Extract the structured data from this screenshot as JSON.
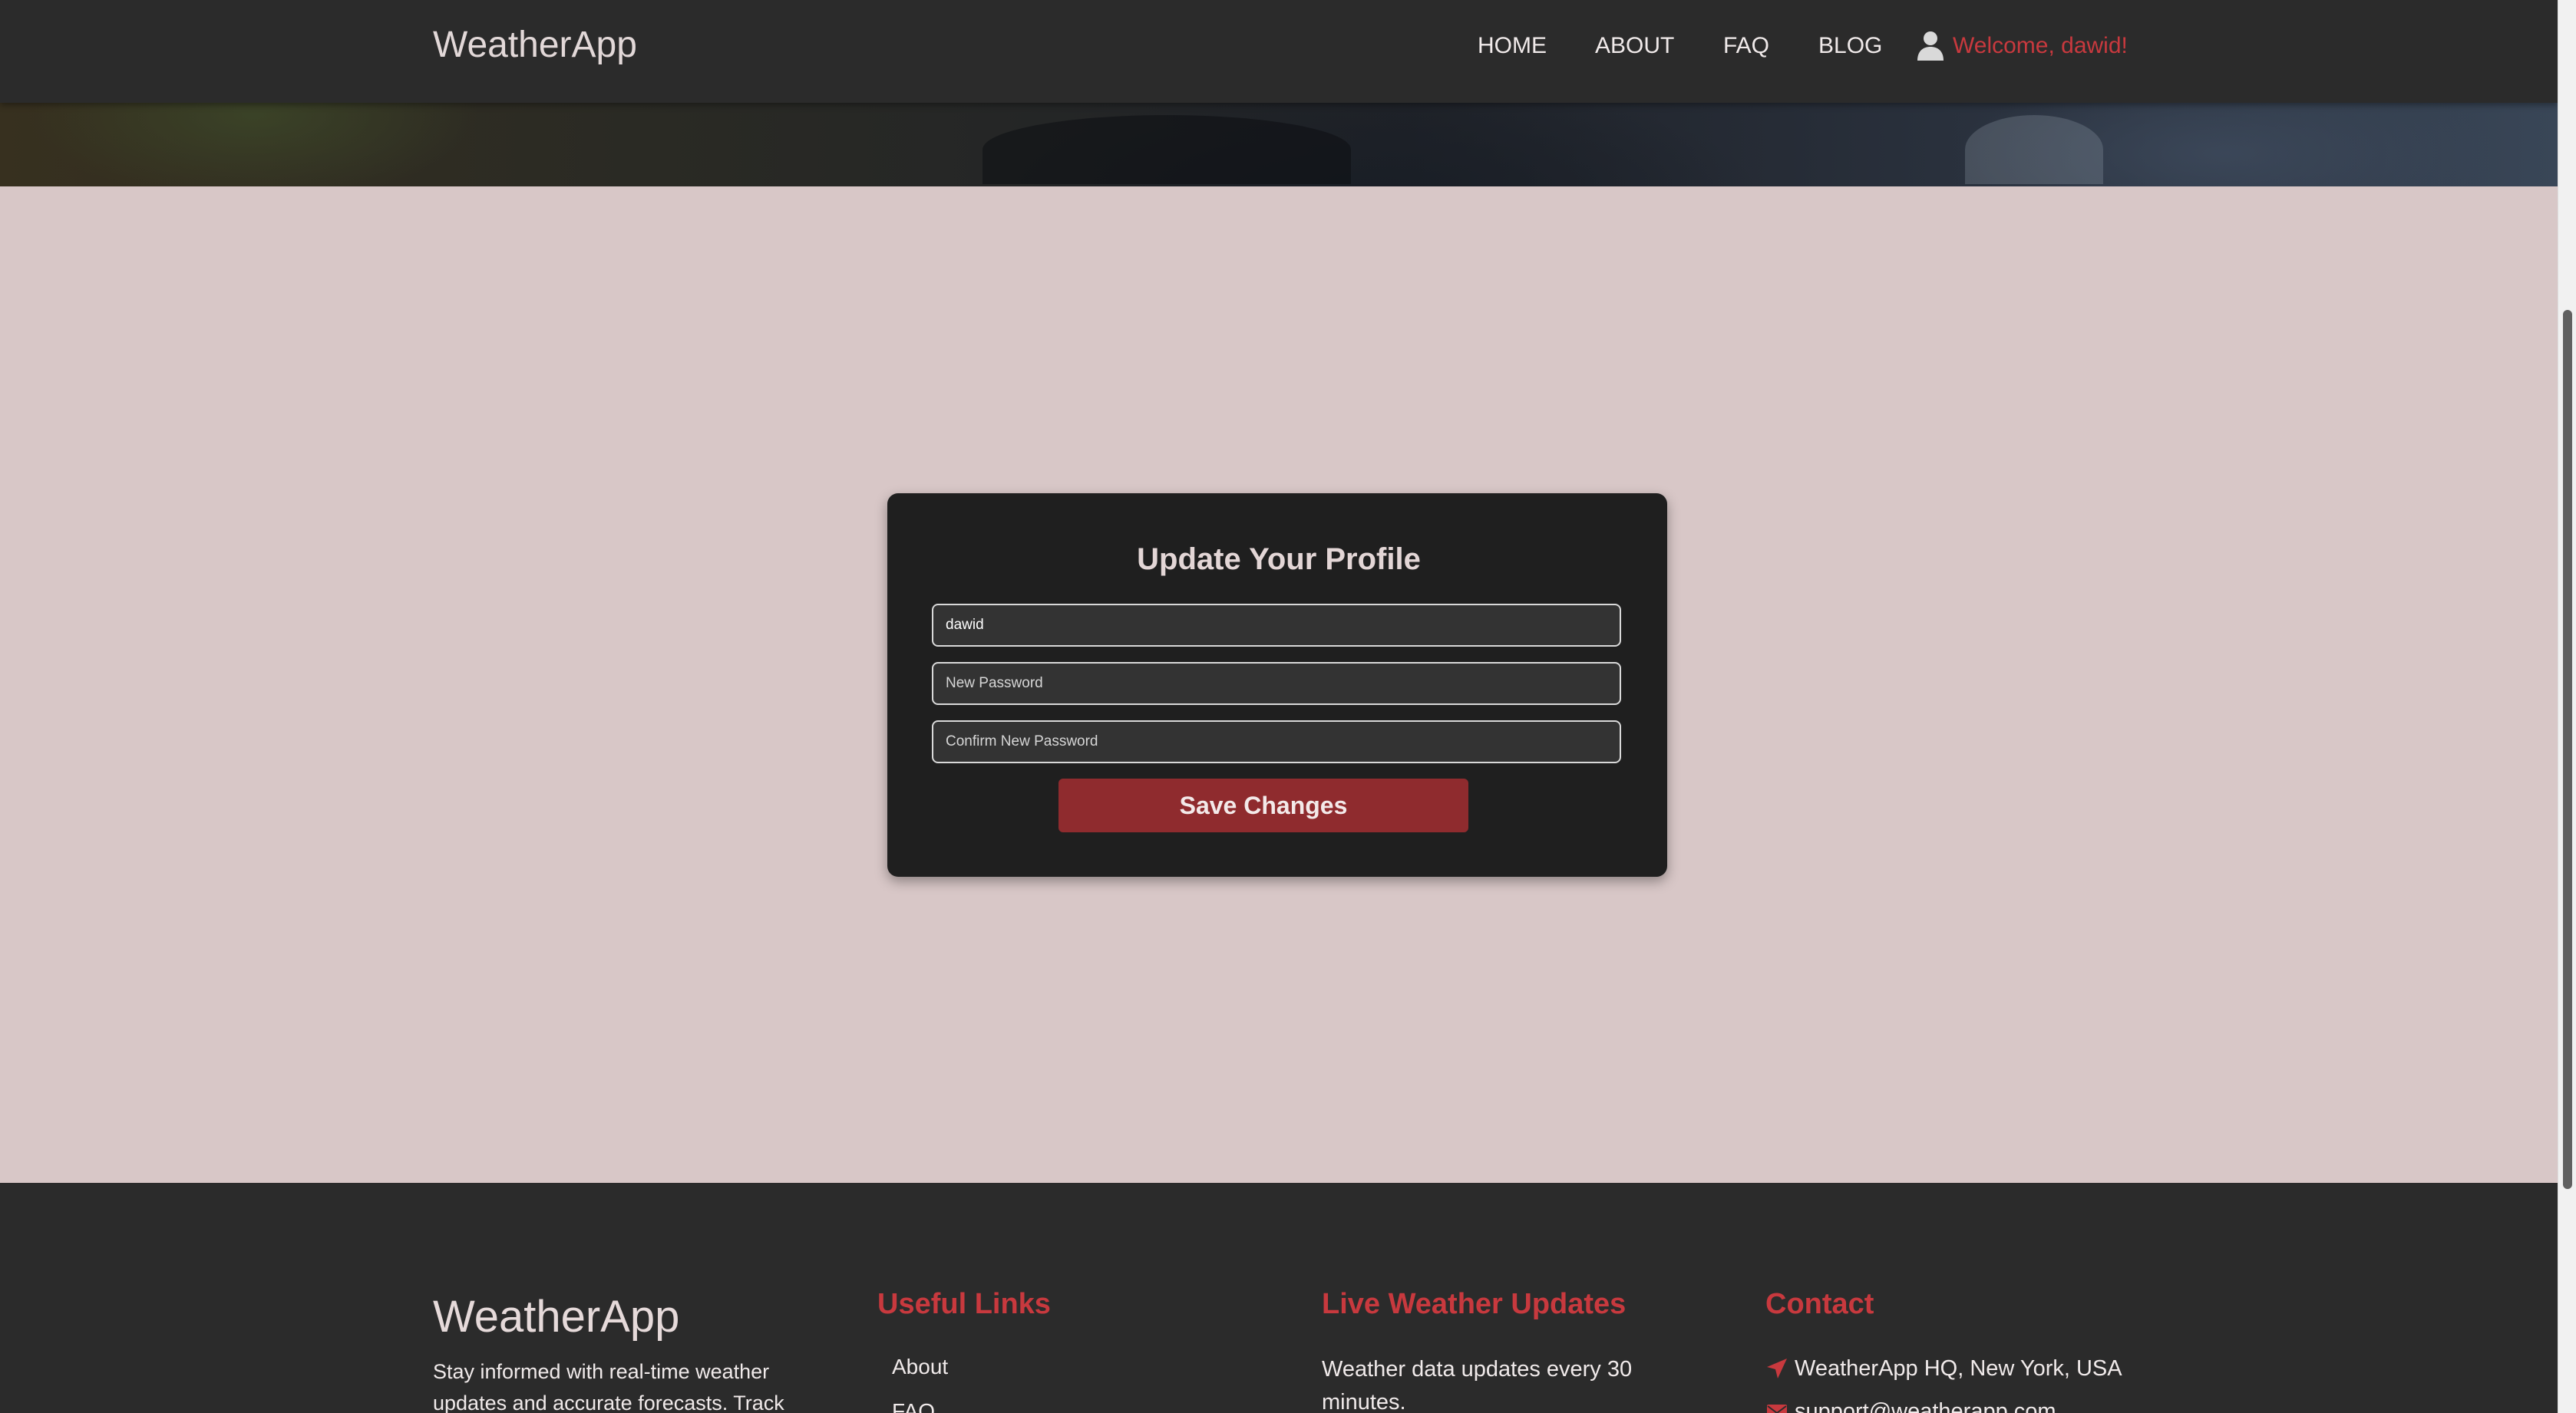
{
  "header": {
    "brand": "WeatherApp",
    "nav": [
      "HOME",
      "ABOUT",
      "FAQ",
      "BLOG"
    ],
    "user_icon": "user-icon",
    "welcome": "Welcome, dawid!"
  },
  "profile_form": {
    "title": "Update Your Profile",
    "username_value": "dawid",
    "new_password_placeholder": "New Password",
    "confirm_password_placeholder": "Confirm New Password",
    "save_label": "Save Changes"
  },
  "footer": {
    "brand": "WeatherApp",
    "about_text": "Stay informed with real-time weather updates and accurate forecasts. Track",
    "useful_links": {
      "heading": "Useful Links",
      "links": [
        "About",
        "FAQ"
      ]
    },
    "live_updates": {
      "heading": "Live Weather Updates",
      "text": "Weather data updates every 30 minutes."
    },
    "contact": {
      "heading": "Contact",
      "address": "WeatherApp HQ, New York, USA",
      "address_icon": "location-arrow-icon",
      "email": "support@weatherapp.com",
      "email_icon": "envelope-icon"
    }
  },
  "colors": {
    "accent": "#c8393e",
    "button": "#8f2b2e",
    "navbar": "#2b2b2b",
    "card": "#1f1f1f",
    "page_background": "#d8c7c7"
  }
}
